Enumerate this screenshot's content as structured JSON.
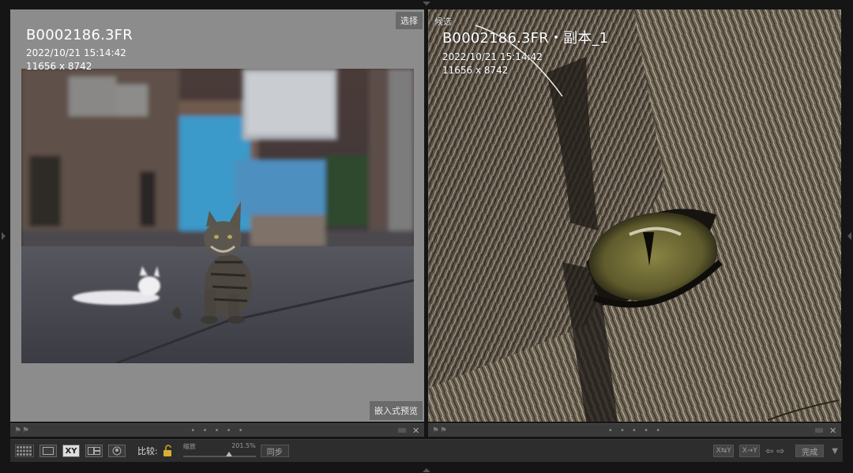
{
  "select_pane": {
    "tag": "选择",
    "file_name": "B0002186.3FR",
    "datetime": "2022/10/21 15:14:42",
    "dimensions": "11656 x 8742",
    "preview_label": "嵌入式预览"
  },
  "candidate_pane": {
    "tag": "候选",
    "file_name": "B0002186.3FR・副本_1",
    "datetime": "2022/10/21 15:14:42",
    "dimensions": "11656 x 8742"
  },
  "subbar": {
    "dots": "• • • • •",
    "close": "✕"
  },
  "toolbar": {
    "compare_xy": "XY",
    "compare_label": "比较:",
    "zoom_label": "缩放",
    "zoom_value": "201.5%",
    "zoom_level": 0.63,
    "sync_label": "同步",
    "swap_label": "X⇆Y",
    "copy_label": "X→Y",
    "arrows": "⇦⇨",
    "done_label": "完成",
    "menu": "▼"
  },
  "icons": [
    "grid-icon",
    "loupe-icon",
    "compare-icon",
    "survey-icon",
    "people-icon",
    "lock-icon",
    "flag-icon",
    "close-icon"
  ],
  "colors": {
    "select_bg": "#8c8c8c",
    "toolbar_bg": "#2d2d2d",
    "panel_bg": "#151515"
  }
}
